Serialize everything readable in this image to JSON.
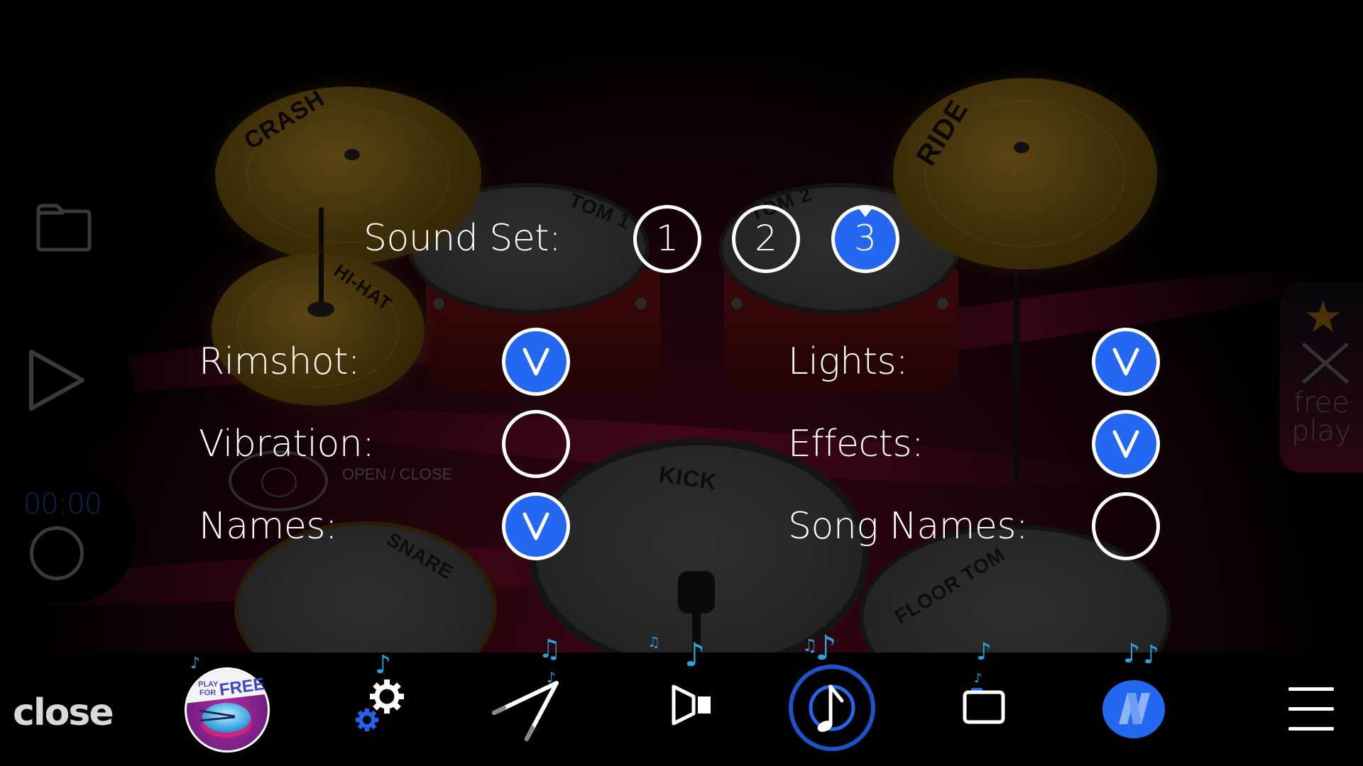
{
  "app": {
    "name": "Drum kit"
  },
  "kit": {
    "pieces": {
      "crash": "CRASH",
      "hihat": "HI-HAT",
      "ride": "RIDE",
      "tom1": "TOM 1",
      "tom2": "TOM 2",
      "kick": "KICK",
      "snare": "SNARE",
      "floor_tom": "FLOOR TOM"
    },
    "hihat_hint": "OPEN / CLOSE"
  },
  "sidebar": {
    "folder_icon": "folder-icon",
    "play_icon": "play-icon",
    "timer": "00:00",
    "record_icon": "record-icon"
  },
  "free_play": {
    "line1": "free",
    "line2": "play",
    "star_icon": "star-icon",
    "sticks_icon": "crossed-sticks-icon"
  },
  "settings": {
    "sound_set": {
      "label": "Sound Set:",
      "options": [
        "1",
        "2",
        "3"
      ],
      "selected": "3"
    },
    "left_options": [
      {
        "label": "Rimshot:",
        "checked": true
      },
      {
        "label": "Vibration:",
        "checked": false
      },
      {
        "label": "Names:",
        "checked": true
      }
    ],
    "right_options": [
      {
        "label": "Lights:",
        "checked": true
      },
      {
        "label": "Effects:",
        "checked": true
      },
      {
        "label": "Song Names:",
        "checked": false
      }
    ],
    "check_glyph": "V"
  },
  "toolbar": {
    "close_label": "close",
    "play_for_free": {
      "line1": "PLAY",
      "line2": "FOR",
      "line3": "FREE"
    },
    "items": [
      {
        "name": "play-for-free-button",
        "icon": "drum-badge-icon"
      },
      {
        "name": "settings-button",
        "icon": "gears-icon"
      },
      {
        "name": "sticks-button",
        "icon": "drumsticks-icon"
      },
      {
        "name": "sound-button",
        "icon": "speaker-icon"
      },
      {
        "name": "music-button",
        "icon": "music-note-icon",
        "active": true
      },
      {
        "name": "window-button",
        "icon": "window-icon"
      },
      {
        "name": "n-logo-button",
        "icon": "n-logo-icon"
      },
      {
        "name": "menu-button",
        "icon": "hamburger-icon"
      }
    ]
  },
  "colors": {
    "accent": "#2468f2",
    "note": "#29a3df",
    "background": "#000000"
  }
}
